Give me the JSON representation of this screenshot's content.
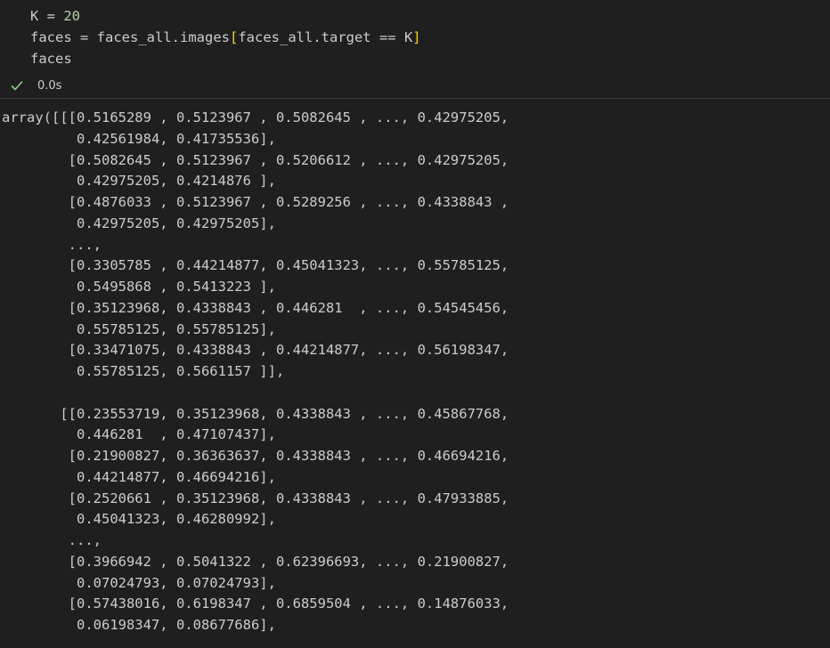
{
  "cell": {
    "code_lines": [
      [
        {
          "t": "K",
          "c": "tok-var"
        },
        {
          "t": " = ",
          "c": "tok-op"
        },
        {
          "t": "20",
          "c": "tok-num"
        }
      ],
      [
        {
          "t": "faces",
          "c": "tok-var"
        },
        {
          "t": " = ",
          "c": "tok-op"
        },
        {
          "t": "faces_all.images",
          "c": "tok-var"
        },
        {
          "t": "[",
          "c": "tok-bracket"
        },
        {
          "t": "faces_all.target == K",
          "c": "tok-var"
        },
        {
          "t": "]",
          "c": "tok-bracket"
        }
      ],
      [
        {
          "t": "faces",
          "c": "tok-var"
        }
      ]
    ],
    "status_icon": "check-icon",
    "exec_time": "0.0s"
  },
  "output": {
    "lines": [
      "array([[[0.5165289 , 0.5123967 , 0.5082645 , ..., 0.42975205,",
      "         0.42561984, 0.41735536],",
      "        [0.5082645 , 0.5123967 , 0.5206612 , ..., 0.42975205,",
      "         0.42975205, 0.4214876 ],",
      "        [0.4876033 , 0.5123967 , 0.5289256 , ..., 0.4338843 ,",
      "         0.42975205, 0.42975205],",
      "        ...,",
      "        [0.3305785 , 0.44214877, 0.45041323, ..., 0.55785125,",
      "         0.5495868 , 0.5413223 ],",
      "        [0.35123968, 0.4338843 , 0.446281  , ..., 0.54545456,",
      "         0.55785125, 0.55785125],",
      "        [0.33471075, 0.4338843 , 0.44214877, ..., 0.56198347,",
      "         0.55785125, 0.5661157 ]],",
      "",
      "       [[0.23553719, 0.35123968, 0.4338843 , ..., 0.45867768,",
      "         0.446281  , 0.47107437],",
      "        [0.21900827, 0.36363637, 0.4338843 , ..., 0.46694216,",
      "         0.44214877, 0.46694216],",
      "        [0.2520661 , 0.35123968, 0.4338843 , ..., 0.47933885,",
      "         0.45041323, 0.46280992],",
      "        ...,",
      "        [0.3966942 , 0.5041322 , 0.62396693, ..., 0.21900827,",
      "         0.07024793, 0.07024793],",
      "        [0.57438016, 0.6198347 , 0.6859504 , ..., 0.14876033,",
      "         0.06198347, 0.08677686],"
    ]
  }
}
